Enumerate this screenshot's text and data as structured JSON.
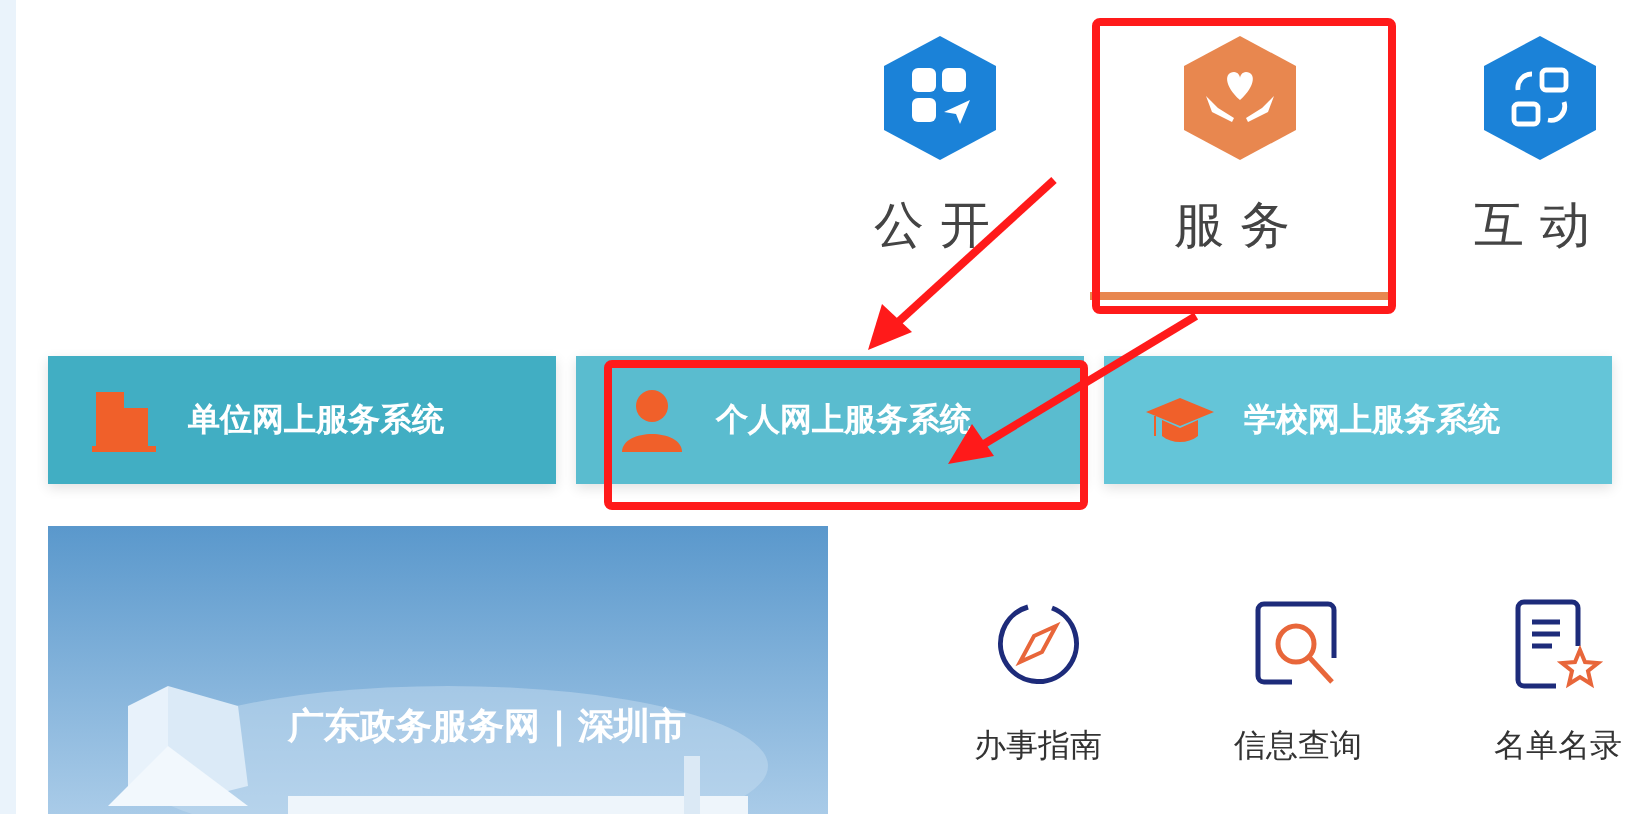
{
  "tabs": [
    {
      "label": "公开",
      "kind": "apps",
      "selected": false
    },
    {
      "label": "服务",
      "kind": "care",
      "selected": true
    },
    {
      "label": "互动",
      "kind": "swap",
      "selected": false
    }
  ],
  "systems": [
    {
      "label": "单位网上服务系统",
      "kind": "building",
      "color": "#41aec3"
    },
    {
      "label": "个人网上服务系统",
      "kind": "person",
      "color": "#5abccf"
    },
    {
      "label": "学校网上服务系统",
      "kind": "cap",
      "color": "#64c5d8"
    }
  ],
  "banner": {
    "kind": "picture",
    "title": "广东政务服务网 | 深圳市"
  },
  "quick_links": [
    {
      "label": "办事指南",
      "kind": "compass"
    },
    {
      "label": "信息查询",
      "kind": "search"
    },
    {
      "label": "名单名录",
      "kind": "list"
    }
  ]
}
